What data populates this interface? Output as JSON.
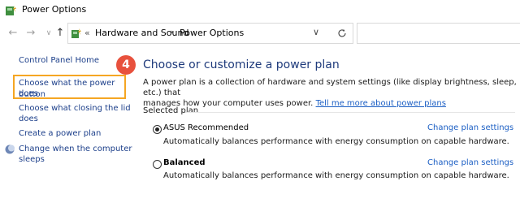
{
  "window": {
    "title": "Power Options"
  },
  "address": {
    "crumbs": [
      "Hardware and Sound",
      "Power Options"
    ],
    "prefix": "«"
  },
  "sidebar": {
    "home": "Control Panel Home",
    "items": [
      {
        "label_line1": "Choose what the power button",
        "label_line2": "does"
      },
      {
        "label_line1": "Choose what closing the lid",
        "label_line2": "does"
      },
      {
        "label_line1": "Create a power plan"
      },
      {
        "label_line1": "Change when the computer",
        "label_line2": "sleeps"
      }
    ]
  },
  "step_badge": "4",
  "main": {
    "title": "Choose or customize a power plan",
    "intro_line1": "A power plan is a collection of hardware and system settings (like display brightness, sleep, etc.) that",
    "intro_line2": "manages how your computer uses power.",
    "intro_link": "Tell me more about power plans",
    "selected_label": "Selected plan",
    "plans": [
      {
        "name": "ASUS Recommended",
        "desc": "Automatically balances performance with energy consumption on capable hardware.",
        "link": "Change plan settings",
        "selected": true
      },
      {
        "name": "Balanced",
        "desc": "Automatically balances performance with energy consumption on capable hardware.",
        "link": "Change plan settings",
        "selected": false
      }
    ]
  },
  "colors": {
    "accent_link": "#1c5fc4",
    "highlight": "#f5a623",
    "badge": "#e8513d"
  }
}
